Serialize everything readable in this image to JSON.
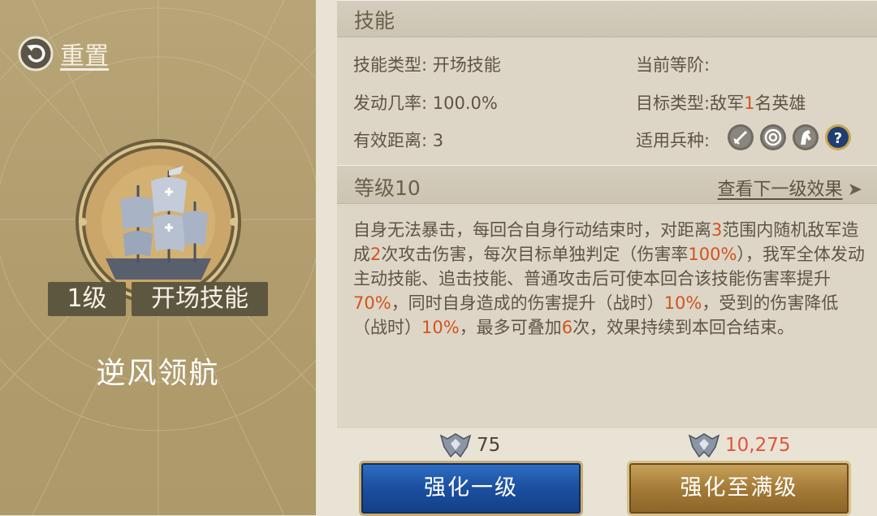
{
  "reset": {
    "label": "重置"
  },
  "skill": {
    "level_tag": "1级",
    "type_tag": "开场技能",
    "name": "逆风领航"
  },
  "panel": {
    "skill_section_title": "技能",
    "info": {
      "skill_type_label": "技能类型:",
      "skill_type_value": "开场技能",
      "current_rank_label": "当前等阶:",
      "trigger_rate_label": "发动几率:",
      "trigger_rate_value": "100.0%",
      "target_type_label": "目标类型:",
      "target_type_pre": "敌军",
      "target_type_num": "1",
      "target_type_post": "名英雄",
      "range_label": "有效距离:",
      "range_value": "3",
      "troop_types_label": "适用兵种:",
      "troop_types": [
        "sword-icon",
        "target-icon",
        "horse-icon",
        "question-icon"
      ]
    },
    "level_section_title": "等级10",
    "next_level_link": "查看下一级效果",
    "description": [
      {
        "t": "自身无法暴击，每回合自身行动结束时，对距离"
      },
      {
        "t": "3",
        "hl": true
      },
      {
        "t": "范围内随机敌军造成"
      },
      {
        "t": "2",
        "hl": true
      },
      {
        "t": "次攻击伤害，每次目标单独判定（伤害率"
      },
      {
        "t": "100%",
        "hl": true
      },
      {
        "t": "），我军全体发动主动技能、追击技能、普通攻击后可使本回合该技能伤害率提升"
      },
      {
        "t": "70%",
        "hl": true
      },
      {
        "t": "，同时自身造成的伤害提升（战时）"
      },
      {
        "t": "10%",
        "hl": true
      },
      {
        "t": "，受到的伤害降低（战时）"
      },
      {
        "t": "10%",
        "hl": true
      },
      {
        "t": "，最多可叠加"
      },
      {
        "t": "6",
        "hl": true
      },
      {
        "t": "次，效果持续到本回合结束。"
      }
    ]
  },
  "costs": {
    "upgrade_one": "75",
    "upgrade_max": "10,275"
  },
  "buttons": {
    "upgrade_one": "强化一级",
    "upgrade_max": "强化至满级"
  },
  "colors": {
    "highlight": "#d2531f",
    "max_cost": "#e0553a",
    "left_panel": "#b09c6d",
    "blue_button": "#1b4f9f",
    "gold_button": "#a47b37"
  }
}
